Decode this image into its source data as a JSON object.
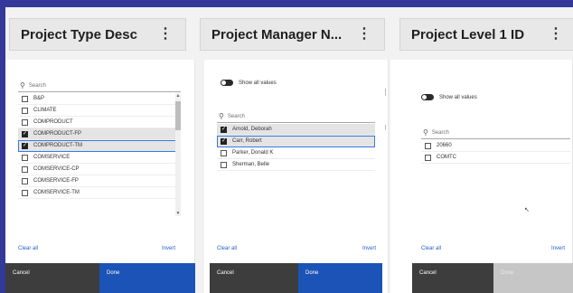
{
  "columns": [
    {
      "header": "Project Type Desc",
      "search_placeholder": "Search",
      "items": [
        {
          "label": "B&P",
          "checked": false,
          "state": "normal"
        },
        {
          "label": "CLIMATE",
          "checked": false,
          "state": "normal"
        },
        {
          "label": "COMPRODUCT",
          "checked": false,
          "state": "normal"
        },
        {
          "label": "COMPRODUCT-FP",
          "checked": true,
          "state": "selected"
        },
        {
          "label": "COMPRODUCT-TM",
          "checked": true,
          "state": "focused"
        },
        {
          "label": "COMSERVICE",
          "checked": false,
          "state": "normal"
        },
        {
          "label": "COMSERVICE-CP",
          "checked": false,
          "state": "normal"
        },
        {
          "label": "COMSERVICE-FP",
          "checked": false,
          "state": "normal"
        },
        {
          "label": "COMSERVICE-TM",
          "checked": false,
          "state": "normal"
        }
      ],
      "clear_label": "Clear all",
      "invert_label": "Invert",
      "cancel_label": "Cancel",
      "done_label": "Done"
    },
    {
      "header": "Project Manager N...",
      "toggle_label": "Show all values",
      "search_placeholder": "Search",
      "items": [
        {
          "label": "Arnold, Deborah",
          "checked": true,
          "state": "selected"
        },
        {
          "label": "Carr, Robert",
          "checked": true,
          "state": "focused"
        },
        {
          "label": "Parker, Donald K",
          "checked": false,
          "state": "normal"
        },
        {
          "label": "Sherman, Belle",
          "checked": false,
          "state": "normal"
        }
      ],
      "clear_label": "Clear all",
      "invert_label": "Invert",
      "cancel_label": "Cancel",
      "done_label": "Done"
    },
    {
      "header": "Project Level 1 ID",
      "toggle_label": "Show all values",
      "search_placeholder": "Search",
      "items": [
        {
          "label": "20660",
          "checked": false,
          "state": "normal"
        },
        {
          "label": "COMTC",
          "checked": false,
          "state": "normal"
        }
      ],
      "clear_label": "Clear all",
      "invert_label": "Invert",
      "cancel_label": "Cancel",
      "done_label": "Done"
    }
  ],
  "menu_glyph": "⋮",
  "search_glyph": "⚲",
  "check_glyph": "✓",
  "colors": {
    "background": "#33389a",
    "done_button": "#1b53b6",
    "cancel_button": "#3d3d3d",
    "link": "#1d5ec9",
    "focus_outline": "#3b78e7"
  }
}
